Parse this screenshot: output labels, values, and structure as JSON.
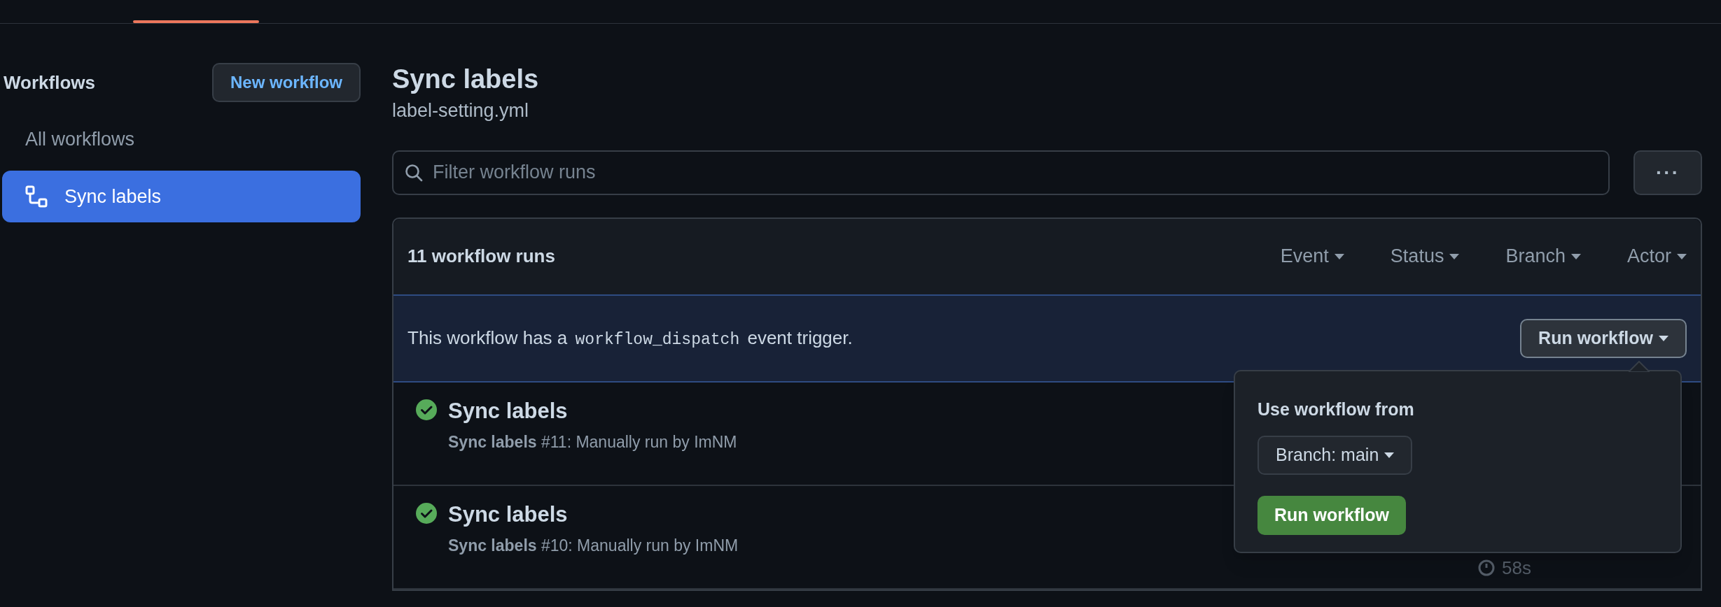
{
  "sidebar": {
    "title": "Workflows",
    "new_button": "New workflow",
    "items": [
      {
        "label": "All workflows",
        "selected": false,
        "kind": "all"
      },
      {
        "label": "Sync labels",
        "selected": true,
        "kind": "workflow"
      }
    ]
  },
  "header": {
    "title": "Sync labels",
    "file": "label-setting.yml"
  },
  "search": {
    "placeholder": "Filter workflow runs"
  },
  "more_button": "···",
  "runs": {
    "count": "11 workflow runs",
    "filters": [
      "Event",
      "Status",
      "Branch",
      "Actor"
    ],
    "banner": {
      "prefix": "This workflow has a",
      "code": "workflow_dispatch",
      "suffix": "event trigger.",
      "button": "Run workflow"
    },
    "rows": [
      {
        "kind": "success",
        "title": "Sync labels",
        "subtitle": "**Sync labels** #11: Manually run by ImNM"
      },
      {
        "kind": "success",
        "title": "Sync labels",
        "subtitle": "**Sync labels** #10: Manually run by ImNM",
        "duration": "58s"
      }
    ]
  },
  "popover": {
    "label": "Use workflow from",
    "branch": "Branch: main",
    "run_button": "Run workflow"
  }
}
